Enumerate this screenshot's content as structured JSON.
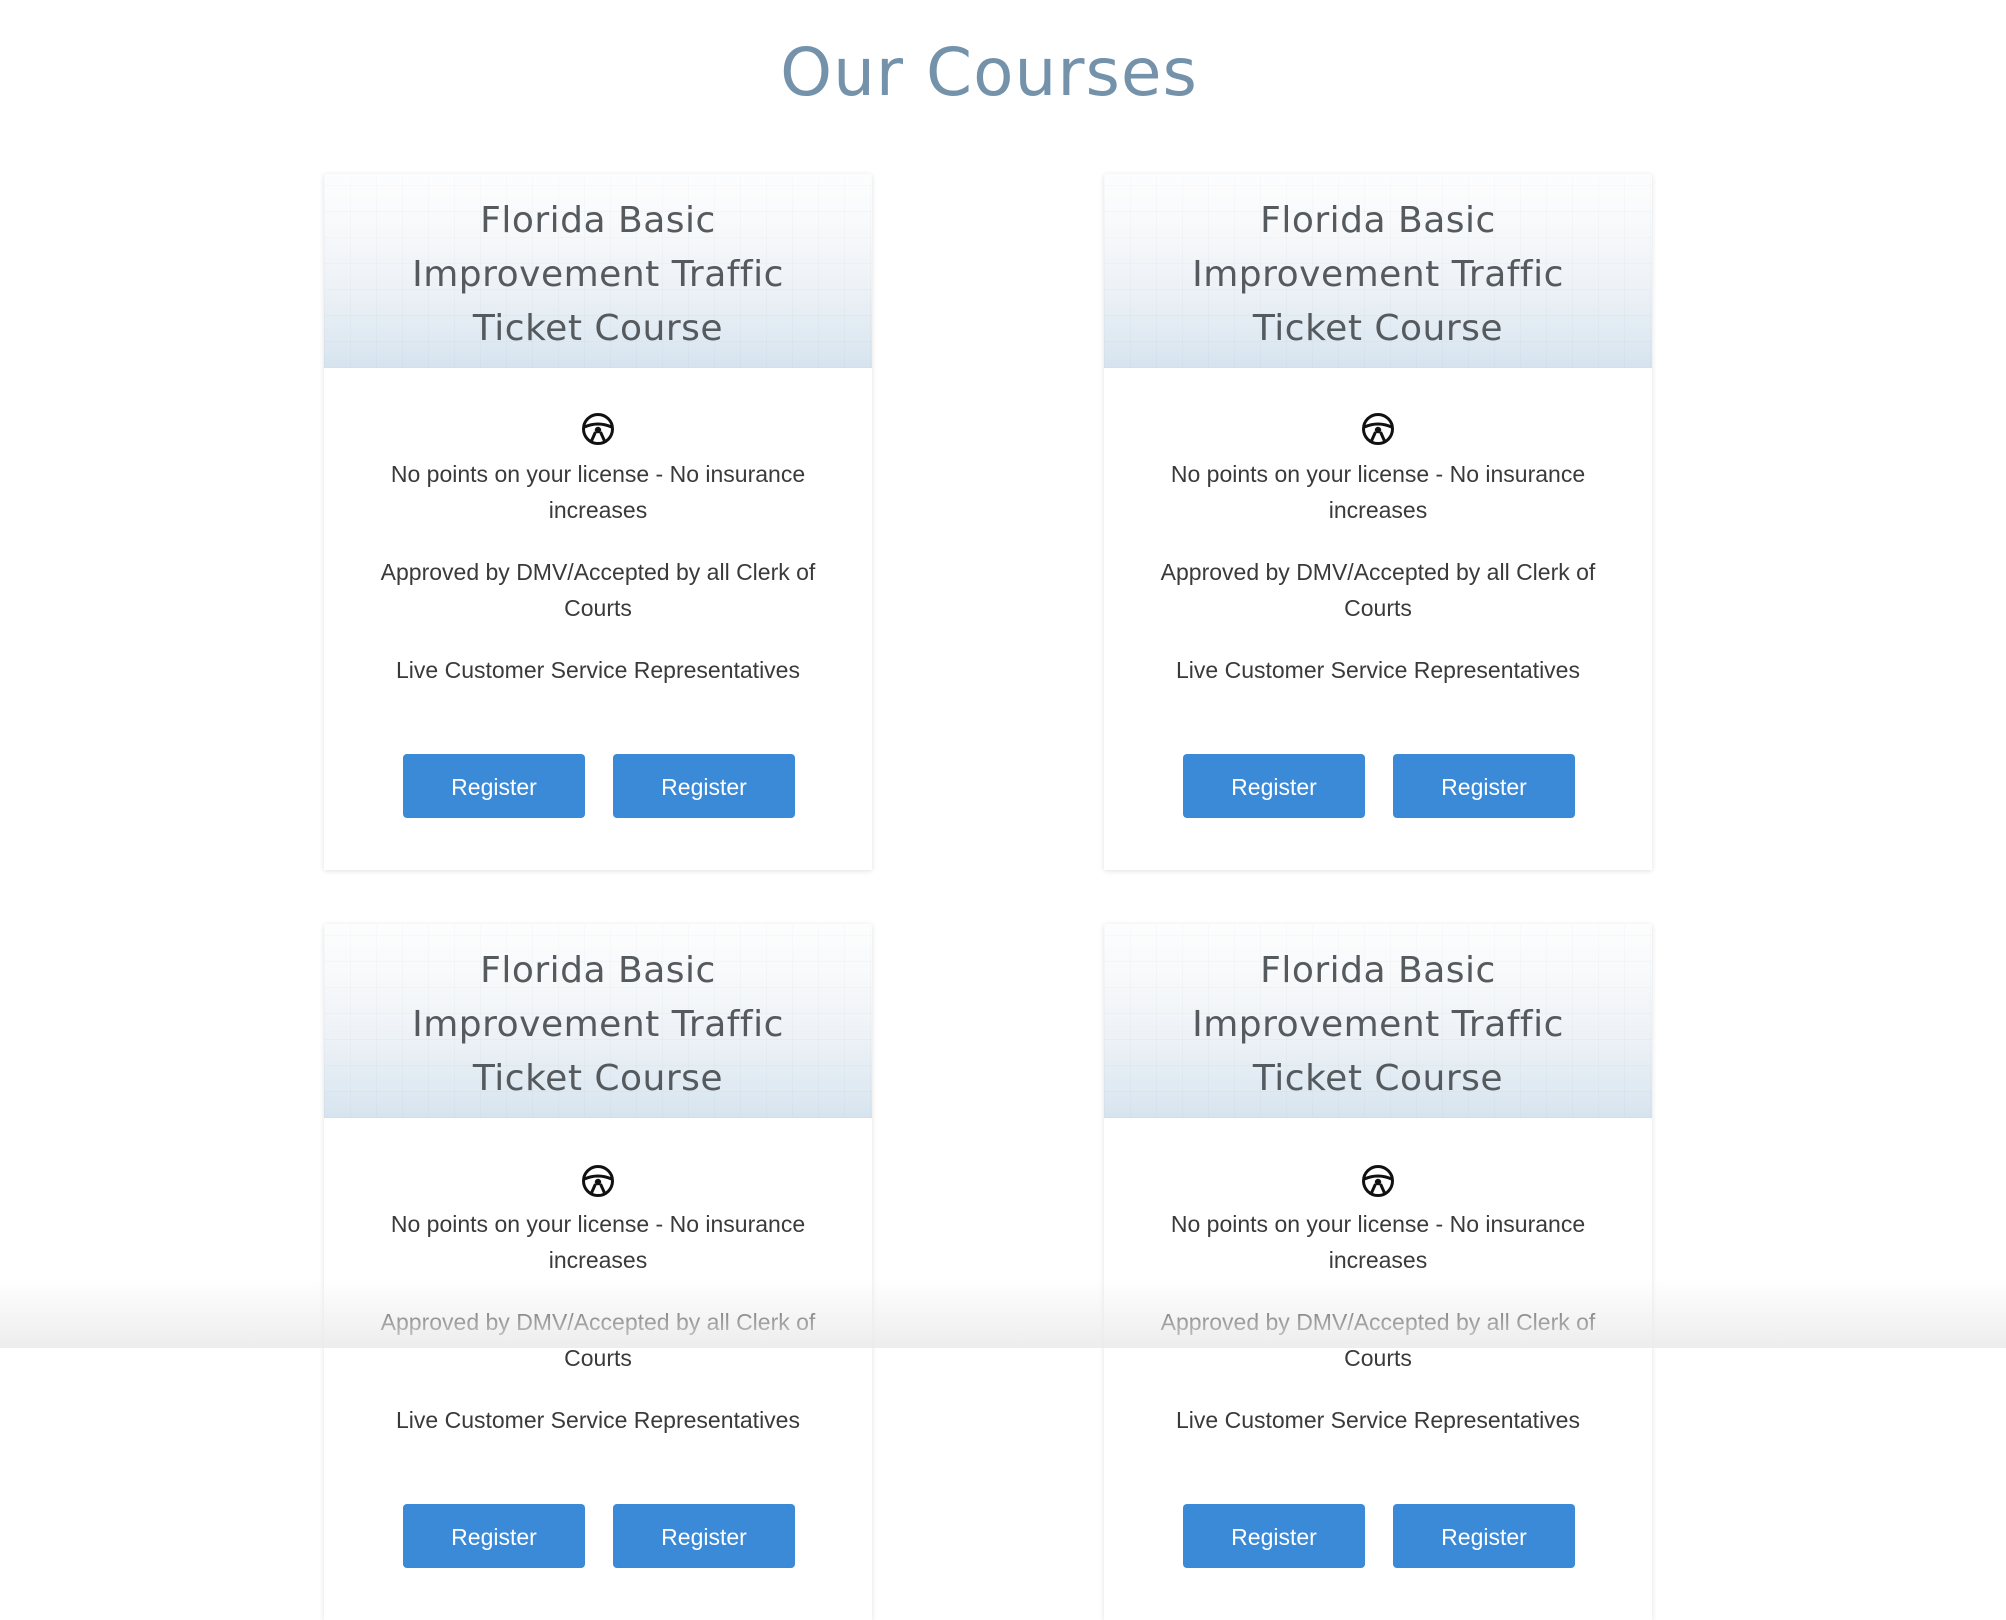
{
  "page": {
    "title": "Our Courses"
  },
  "courses": [
    {
      "title": "Florida Basic Improvement Traffic Ticket Course",
      "icon": "steering-wheel-icon",
      "features": [
        "No points on your license - No insurance increases",
        "Approved by DMV/Accepted by all Clerk of Courts",
        "Live Customer Service Representatives"
      ],
      "buttons": [
        "Register",
        "Register"
      ]
    },
    {
      "title": "Florida Basic Improvement Traffic Ticket Course",
      "icon": "steering-wheel-icon",
      "features": [
        "No points on your license - No insurance increases",
        "Approved by DMV/Accepted by all Clerk of Courts",
        "Live Customer Service Representatives"
      ],
      "buttons": [
        "Register",
        "Register"
      ]
    },
    {
      "title": "Florida Basic Improvement Traffic Ticket Course",
      "icon": "steering-wheel-icon",
      "features": [
        "No points on your license - No insurance increases",
        "Approved by DMV/Accepted by all Clerk of Courts",
        "Live Customer Service Representatives"
      ],
      "buttons": [
        "Register",
        "Register"
      ]
    },
    {
      "title": "Florida Basic Improvement Traffic Ticket Course",
      "icon": "steering-wheel-icon",
      "features": [
        "No points on your license - No insurance increases",
        "Approved by DMV/Accepted by all Clerk of Courts",
        "Live Customer Service Representatives"
      ],
      "buttons": [
        "Register",
        "Register"
      ]
    }
  ],
  "colors": {
    "heading": "#7592ab",
    "button": "#3a8ad8",
    "card_header_bottom": "#d6e4ef",
    "body_text": "#3a3a3a"
  }
}
